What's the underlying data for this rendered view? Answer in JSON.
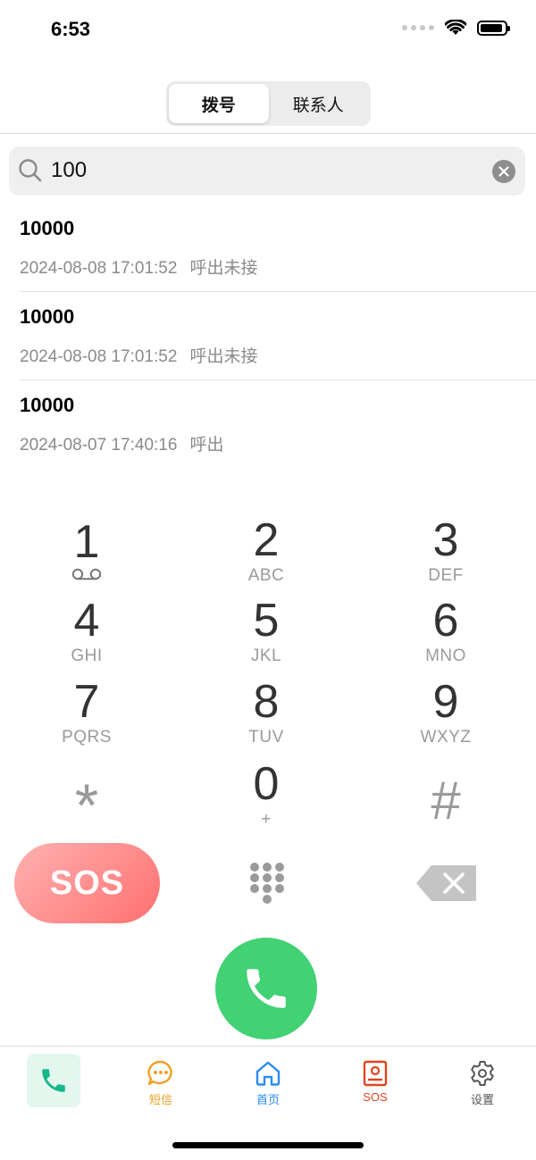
{
  "status_bar": {
    "time": "6:53"
  },
  "segment": {
    "tabs": [
      "拨号",
      "联系人"
    ],
    "active": 0
  },
  "search": {
    "value": "100",
    "placeholder": ""
  },
  "call_log": [
    {
      "number": "10000",
      "datetime": "2024-08-08 17:01:52",
      "status": "呼出未接"
    },
    {
      "number": "10000",
      "datetime": "2024-08-08 17:01:52",
      "status": "呼出未接"
    },
    {
      "number": "10000",
      "datetime": "2024-08-07 17:40:16",
      "status": "呼出"
    }
  ],
  "keypad": [
    {
      "digit": "1",
      "letters": ""
    },
    {
      "digit": "2",
      "letters": "ABC"
    },
    {
      "digit": "3",
      "letters": "DEF"
    },
    {
      "digit": "4",
      "letters": "GHI"
    },
    {
      "digit": "5",
      "letters": "JKL"
    },
    {
      "digit": "6",
      "letters": "MNO"
    },
    {
      "digit": "7",
      "letters": "PQRS"
    },
    {
      "digit": "8",
      "letters": "TUV"
    },
    {
      "digit": "9",
      "letters": "WXYZ"
    },
    {
      "digit": "*",
      "letters": ""
    },
    {
      "digit": "0",
      "letters": "+"
    },
    {
      "digit": "#",
      "letters": ""
    }
  ],
  "actions": {
    "sos_label": "SOS"
  },
  "tabbar": {
    "items": [
      {
        "label": "",
        "icon": "phone-icon",
        "color": "#14b88a"
      },
      {
        "label": "短信",
        "icon": "message-icon",
        "color": "#f0a020"
      },
      {
        "label": "首页",
        "icon": "home-icon",
        "color": "#2a8af0"
      },
      {
        "label": "SOS",
        "icon": "sos-card-icon",
        "color": "#e0451f"
      },
      {
        "label": "设置",
        "icon": "gear-icon",
        "color": "#555555"
      }
    ]
  },
  "colors": {
    "call_green": "#42d173",
    "sos_red": "#ff7f7f",
    "active_tab_bg": "#e3f7ef"
  }
}
